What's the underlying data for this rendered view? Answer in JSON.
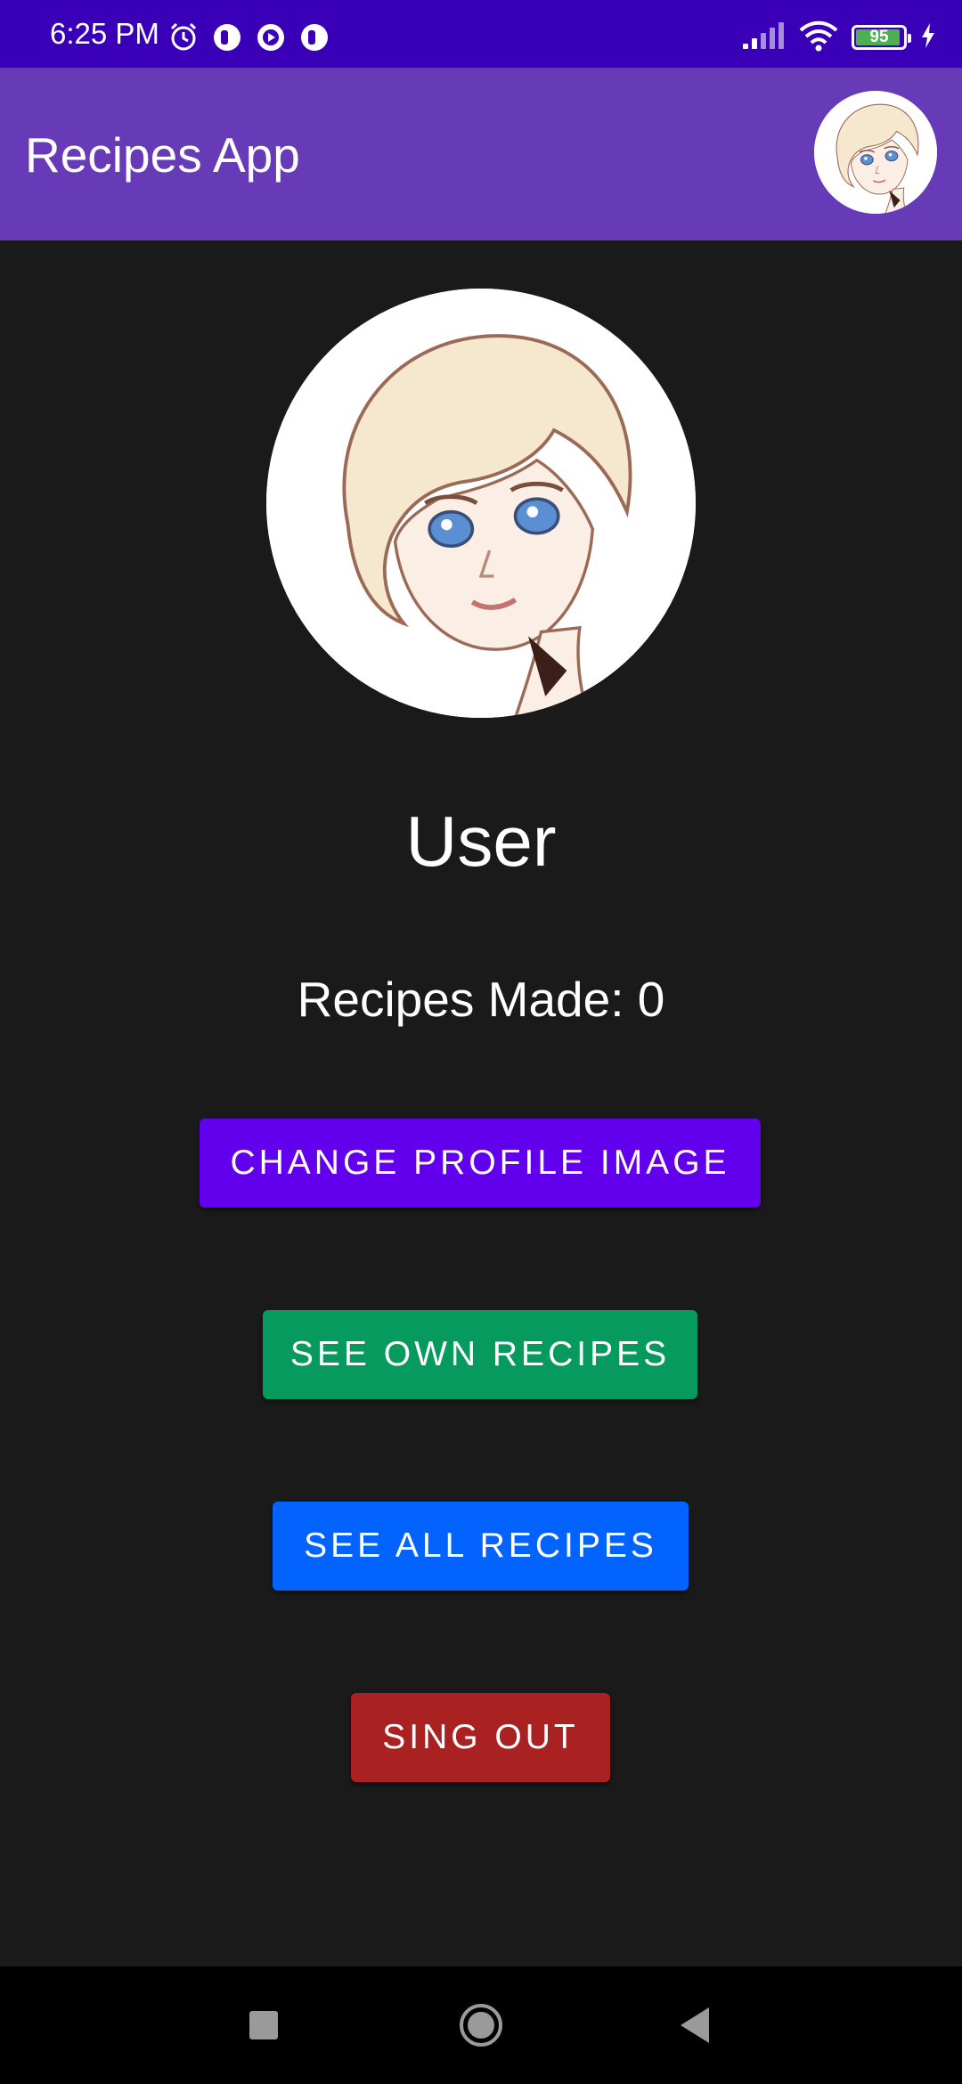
{
  "status_bar": {
    "time": "6:25 PM",
    "battery_level": "95",
    "left_icons": [
      "alarm-icon",
      "notification-icon",
      "media-icon",
      "notification-icon"
    ],
    "right_icons": [
      "signal-icon",
      "wifi-icon",
      "battery-icon",
      "charging-icon"
    ]
  },
  "app_bar": {
    "title": "Recipes App"
  },
  "profile": {
    "name": "User",
    "recipes_made": "Recipes Made: 0"
  },
  "buttons": {
    "change_profile_image": "CHANGE PROFILE IMAGE",
    "see_own_recipes": "SEE OWN RECIPES",
    "see_all_recipes": "SEE ALL RECIPES",
    "sign_out": "SING OUT"
  },
  "colors": {
    "status_bar": "#3a00b8",
    "app_bar": "#673ab7",
    "background": "#1a1a1b",
    "change_profile_button": "#6200ee",
    "see_own_button": "#079a5e",
    "see_all_button": "#0363ff",
    "sign_out_button": "#aa2121"
  },
  "nav_bar": {
    "icons": [
      "recents-icon",
      "home-icon",
      "back-icon"
    ]
  }
}
